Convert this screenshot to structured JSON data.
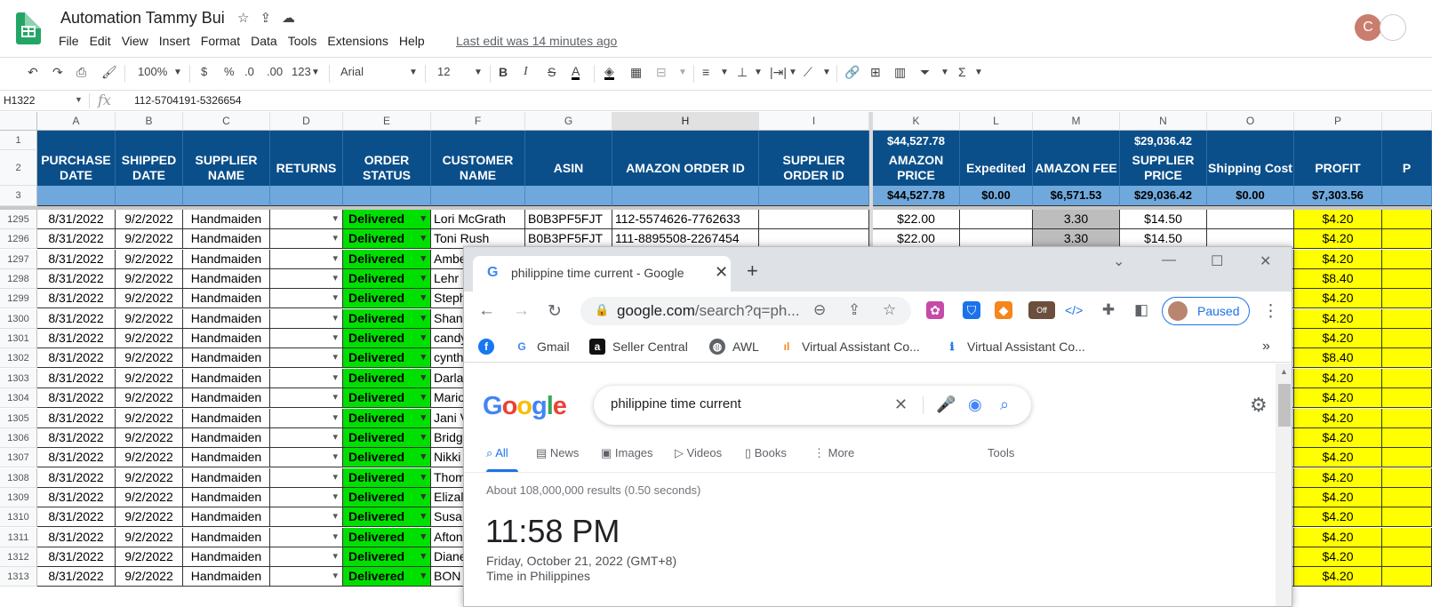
{
  "sheets": {
    "title": "Automation Tammy Bui",
    "menu": [
      "File",
      "Edit",
      "View",
      "Insert",
      "Format",
      "Data",
      "Tools",
      "Extensions",
      "Help"
    ],
    "last_edit": "Last edit was 14 minutes ago",
    "avatar_letter": "C",
    "toolbar": {
      "zoom": "100%",
      "currency": "$",
      "percent": "%",
      "dec_decrease": ".0",
      "dec_increase": ".00",
      "more_formats": "123",
      "font": "Arial",
      "font_size": "12",
      "bold": "B",
      "italic": "I",
      "strike": "S",
      "text_color": "A"
    },
    "name_box": "H1322",
    "fx": "fx",
    "formula": "112-5704191-5326654",
    "columns": [
      "A",
      "B",
      "C",
      "D",
      "E",
      "F",
      "G",
      "H",
      "I",
      "K",
      "L",
      "M",
      "N",
      "O",
      "P"
    ],
    "header_row1": {
      "K": "$44,527.78",
      "N": "$29,036.42"
    },
    "header_row2": {
      "A": "PURCHASE DATE",
      "B": "SHIPPED DATE",
      "C": "SUPPLIER NAME",
      "D": "RETURNS",
      "E": "ORDER STATUS",
      "F": "CUSTOMER NAME",
      "G": "ASIN",
      "H": "AMAZON ORDER ID",
      "I": "SUPPLIER ORDER ID",
      "K": "AMAZON PRICE",
      "L": "Expedited",
      "M": "AMAZON FEE",
      "N": "SUPPLIER PRICE",
      "O": "Shipping Cost",
      "P": "PROFIT",
      "Q": "P"
    },
    "header_row3": {
      "K": "$44,527.78",
      "L": "$0.00",
      "M": "$6,571.53",
      "N": "$29,036.42",
      "O": "$0.00",
      "P": "$7,303.56"
    },
    "rows": [
      {
        "n": "1295",
        "a": "8/31/2022",
        "b": "9/2/2022",
        "c": "Handmaiden",
        "e": "Delivered",
        "f": "Lori McGrath",
        "g": "B0B3PF5FJT",
        "h": "112-5574626-7762633",
        "k": "$22.00",
        "m": "3.30",
        "nn": "$14.50",
        "p": "$4.20"
      },
      {
        "n": "1296",
        "a": "8/31/2022",
        "b": "9/2/2022",
        "c": "Handmaiden",
        "e": "Delivered",
        "f": "Toni Rush",
        "g": "B0B3PF5FJT",
        "h": "111-8895508-2267454",
        "k": "$22.00",
        "m": "3.30",
        "nn": "$14.50",
        "p": "$4.20"
      },
      {
        "n": "1297",
        "a": "8/31/2022",
        "b": "9/2/2022",
        "c": "Handmaiden",
        "e": "Delivered",
        "f": "Ambe",
        "p": "$4.20"
      },
      {
        "n": "1298",
        "a": "8/31/2022",
        "b": "9/2/2022",
        "c": "Handmaiden",
        "e": "Delivered",
        "f": "Lehr",
        "p": "$8.40"
      },
      {
        "n": "1299",
        "a": "8/31/2022",
        "b": "9/2/2022",
        "c": "Handmaiden",
        "e": "Delivered",
        "f": "Steph",
        "p": "$4.20"
      },
      {
        "n": "1300",
        "a": "8/31/2022",
        "b": "9/2/2022",
        "c": "Handmaiden",
        "e": "Delivered",
        "f": "Shan",
        "p": "$4.20"
      },
      {
        "n": "1301",
        "a": "8/31/2022",
        "b": "9/2/2022",
        "c": "Handmaiden",
        "e": "Delivered",
        "f": "candy",
        "p": "$4.20"
      },
      {
        "n": "1302",
        "a": "8/31/2022",
        "b": "9/2/2022",
        "c": "Handmaiden",
        "e": "Delivered",
        "f": "cynth",
        "p": "$8.40"
      },
      {
        "n": "1303",
        "a": "8/31/2022",
        "b": "9/2/2022",
        "c": "Handmaiden",
        "e": "Delivered",
        "f": "Darla",
        "p": "$4.20"
      },
      {
        "n": "1304",
        "a": "8/31/2022",
        "b": "9/2/2022",
        "c": "Handmaiden",
        "e": "Delivered",
        "f": "Mario",
        "p": "$4.20"
      },
      {
        "n": "1305",
        "a": "8/31/2022",
        "b": "9/2/2022",
        "c": "Handmaiden",
        "e": "Delivered",
        "f": "Jani V",
        "p": "$4.20"
      },
      {
        "n": "1306",
        "a": "8/31/2022",
        "b": "9/2/2022",
        "c": "Handmaiden",
        "e": "Delivered",
        "f": "Bridg",
        "p": "$4.20"
      },
      {
        "n": "1307",
        "a": "8/31/2022",
        "b": "9/2/2022",
        "c": "Handmaiden",
        "e": "Delivered",
        "f": "Nikki",
        "p": "$4.20"
      },
      {
        "n": "1308",
        "a": "8/31/2022",
        "b": "9/2/2022",
        "c": "Handmaiden",
        "e": "Delivered",
        "f": "Thom",
        "p": "$4.20"
      },
      {
        "n": "1309",
        "a": "8/31/2022",
        "b": "9/2/2022",
        "c": "Handmaiden",
        "e": "Delivered",
        "f": "Elizal",
        "p": "$4.20"
      },
      {
        "n": "1310",
        "a": "8/31/2022",
        "b": "9/2/2022",
        "c": "Handmaiden",
        "e": "Delivered",
        "f": "Susa",
        "p": "$4.20"
      },
      {
        "n": "1311",
        "a": "8/31/2022",
        "b": "9/2/2022",
        "c": "Handmaiden",
        "e": "Delivered",
        "f": "Afton",
        "p": "$4.20"
      },
      {
        "n": "1312",
        "a": "8/31/2022",
        "b": "9/2/2022",
        "c": "Handmaiden",
        "e": "Delivered",
        "f": "Diane",
        "p": "$4.20"
      },
      {
        "n": "1313",
        "a": "8/31/2022",
        "b": "9/2/2022",
        "c": "Handmaiden",
        "e": "Delivered",
        "f": "BON",
        "p": "$4.20"
      }
    ],
    "colors": {
      "header_blue": "#0b4f8a",
      "row3_blue": "#6fa8dc",
      "status_green": "#00e000",
      "profit_yellow": "#ffff00",
      "fee_gray": "#bdbdbd"
    }
  },
  "chrome": {
    "tab_title": "philippine time current - Google",
    "url_host": "google.com",
    "url_path": "/search?q=ph...",
    "profile_label": "Paused",
    "bookmarks": [
      "Gmail",
      "Seller Central",
      "AWL",
      "Virtual Assistant Co...",
      "Virtual Assistant Co..."
    ],
    "more_bookmarks": "»",
    "ext_off_badge": "Off",
    "google": {
      "logo": "Google",
      "query": "philippine time current",
      "tabs": [
        "All",
        "News",
        "Images",
        "Videos",
        "Books",
        "More",
        "Tools"
      ],
      "result_stats": "About 108,000,000 results (0.50 seconds)",
      "time": "11:58 PM",
      "date": "Friday, October 21, 2022 (GMT+8)",
      "timezone": "Time in Philippines"
    }
  }
}
